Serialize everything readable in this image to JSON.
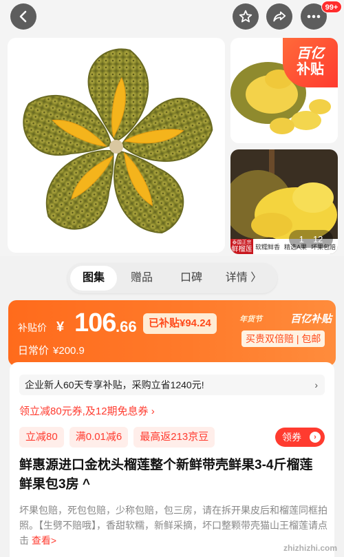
{
  "topbar": {
    "message_count": "99+",
    "icons": [
      "back-icon",
      "star-icon",
      "share-icon",
      "more-icon"
    ]
  },
  "gallery": {
    "subsidy_badge": {
      "line1": "百亿",
      "line2": "补贴"
    },
    "tag_strip": {
      "brand_small": "泰国正宗",
      "brand": "鲜榴莲",
      "tags": [
        "软糯鲜香",
        "精选A果",
        "坏果包赔"
      ]
    },
    "counter": {
      "current": "1",
      "total": "12"
    }
  },
  "tabs": [
    {
      "label": "图集",
      "active": true
    },
    {
      "label": "赠品",
      "active": false
    },
    {
      "label": "口碑",
      "active": false
    },
    {
      "label": "详情 〉",
      "active": false
    }
  ],
  "price": {
    "label": "补贴价",
    "currency": "¥",
    "integer": "106",
    "decimal": ".66",
    "subsidized": "已补贴¥94.24",
    "daily_label": "日常价",
    "daily_value": "¥200.9",
    "festival": "年货节",
    "logo": "百亿补贴",
    "guarantee": "买贵双倍赔 | 包邮"
  },
  "promo": {
    "banner": "企业新人60天专享补贴，采购立省1240元!",
    "chevron": "›",
    "coupon_line": "领立减80元券,及12期免息券 ›",
    "chips": [
      "立减80",
      "满0.01减6",
      "最高返213京豆"
    ],
    "claim_button": "领券",
    "claim_arrow": "›"
  },
  "product": {
    "title": "鲜惠源进口金枕头榴莲整个新鲜带壳鲜果3-4斤榴莲鲜果包3房 ^",
    "description": "坏果包赔，死包包赔，少称包赔，包三房，请在拆开果皮后和榴莲同框拍照。【生劈不赔哦】，香甜软糯，新鲜采摘，坏口整颗带壳猫山王榴莲请点击",
    "see_more": "查看>"
  },
  "watermark": "zhizhizhi.com",
  "colors": {
    "accent": "#ff3b2f",
    "price_card": "#ff7a2a"
  }
}
